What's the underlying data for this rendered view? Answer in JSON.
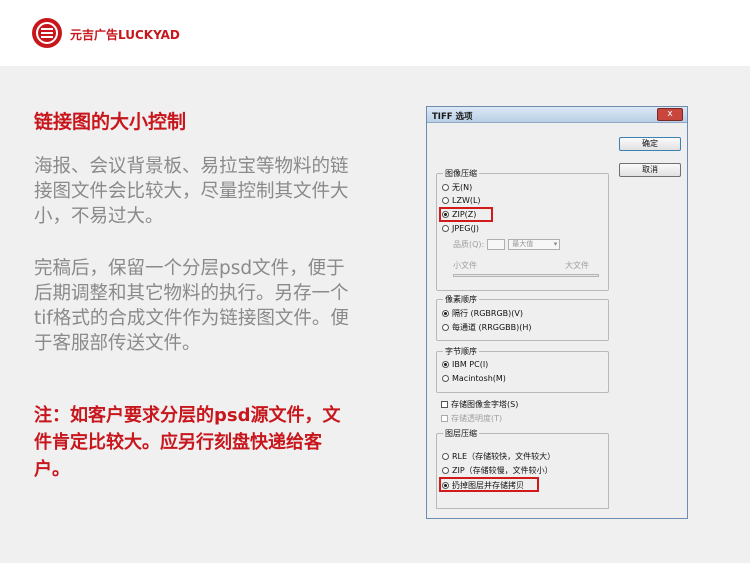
{
  "header": {
    "logo_text": "元吉广告LUCKYAD"
  },
  "slide": {
    "title": "链接图的大小控制",
    "paragraph1": "海报、会议背景板、易拉宝等物料的链接图文件会比较大，尽量控制其文件大小，不易过大。",
    "paragraph2": "完稿后，保留一个分层psd文件，便于后期调整和其它物料的执行。另存一个tif格式的合成文件作为链接图文件。便于客服部传送文件。",
    "note": "注：如客户要求分层的psd源文件，文件肯定比较大。应另行刻盘快递给客户。"
  },
  "dialog": {
    "title": "TIFF 选项",
    "close": "x",
    "ok_label": "确定",
    "cancel_label": "取消",
    "image_compression": {
      "legend": "图像压缩",
      "options": [
        "无(N)",
        "LZW(L)",
        "ZIP(Z)",
        "JPEG(J)"
      ],
      "selected": "ZIP(Z)",
      "quality_label": "品质(Q):",
      "quality_select": "最大值",
      "small_file": "小文件",
      "large_file": "大文件"
    },
    "pixel_order": {
      "legend": "像素顺序",
      "options": [
        "隔行 (RGBRGB)(V)",
        "每通道 (RRGGBB)(H)"
      ],
      "selected": "隔行 (RGBRGB)(V)"
    },
    "byte_order": {
      "legend": "字节顺序",
      "options": [
        "IBM PC(I)",
        "Macintosh(M)"
      ],
      "selected": "IBM PC(I)"
    },
    "save_pyramid": "存储图像金字塔(S)",
    "save_transparency": "存储透明度(T)",
    "layer_compression": {
      "legend": "图层压缩",
      "options": [
        "RLE（存储较快，文件较大）",
        "ZIP（存储较慢，文件较小）",
        "扔掉图层并存储拷贝"
      ],
      "selected": "扔掉图层并存储拷贝"
    },
    "highlight_color": "#d11a1a"
  }
}
